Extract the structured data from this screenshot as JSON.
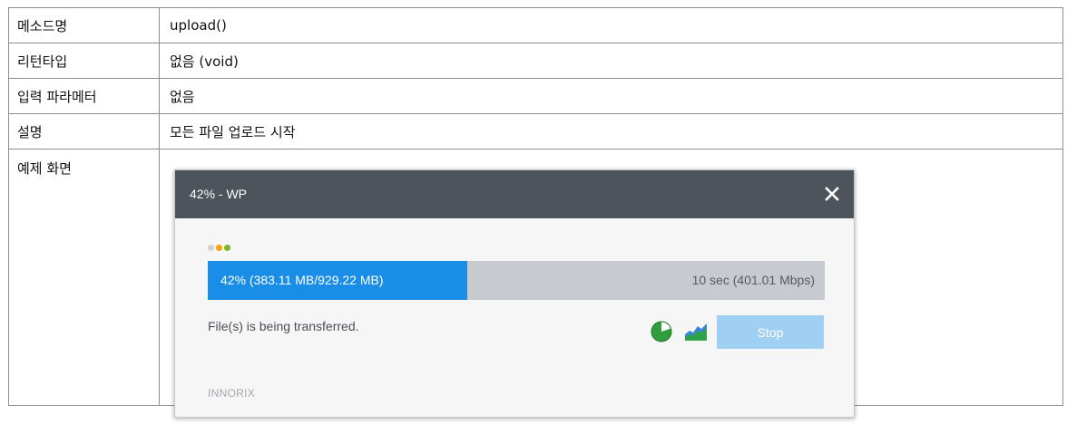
{
  "table": {
    "rows": [
      {
        "key": "메소드명",
        "value": "upload()"
      },
      {
        "key": "리턴타입",
        "value": "없음 (void)"
      },
      {
        "key": "입력 파라메터",
        "value": "없음"
      },
      {
        "key": "설명",
        "value": "모든 파일 업로드 시작"
      },
      {
        "key": "예제 화면",
        "value": ""
      }
    ]
  },
  "dialog": {
    "title": "42% - WP",
    "progress": {
      "percent": 42,
      "label": "42% (383.11 MB/929.22 MB)",
      "rate": "10 sec (401.01 Mbps)"
    },
    "status": "File(s) is being transferred.",
    "stop_label": "Stop",
    "brand": "INNORIX",
    "icons": {
      "close": "close-icon",
      "pie": "pie-chart-icon",
      "graph": "area-graph-icon"
    },
    "colors": {
      "header": "#4e545b",
      "progress_fill": "#1a8ee6",
      "progress_track": "#c7cbd1",
      "stop_button": "#9fcff3",
      "dot_1": "#d3d3d3",
      "dot_2": "#f5a300",
      "dot_3": "#7ab51d"
    }
  }
}
